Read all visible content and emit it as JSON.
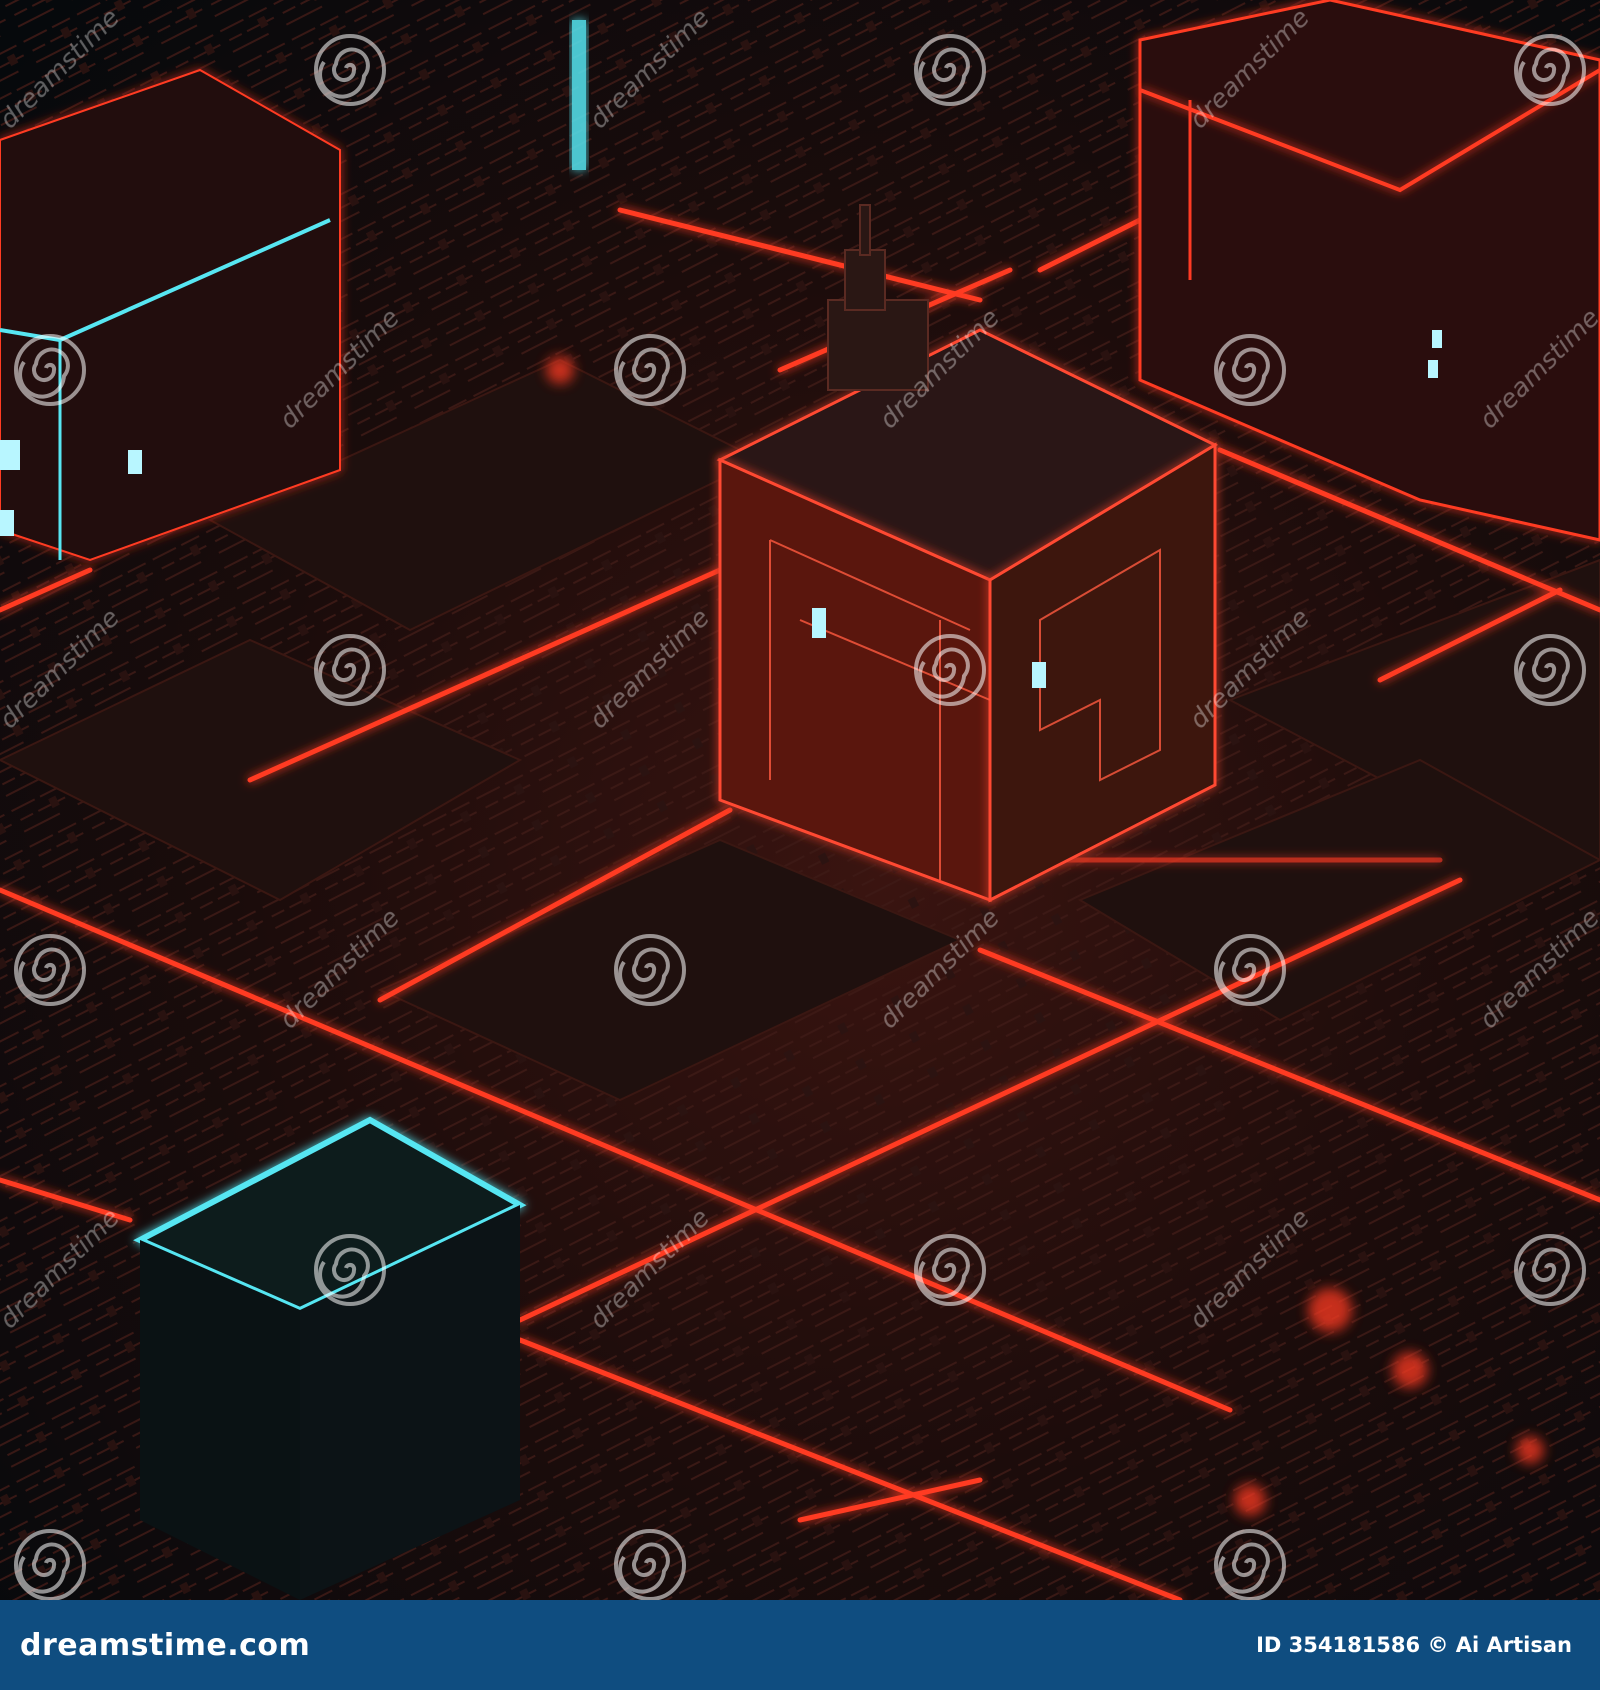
{
  "photo": {
    "description": "Isometric 3D render of a dark circuit-board city grid with red and cyan neon-outlined blocks",
    "colors": {
      "neon_red": "#ff3a24",
      "neon_cyan": "#57e6f2",
      "board_dark": "#1a0d0c",
      "background": "#05080b"
    }
  },
  "watermark": {
    "text": "dreamstime",
    "icon": "dreamstime-spiral-logo"
  },
  "footer": {
    "site": "dreamstime.com",
    "id_label": "ID",
    "id_number": "354181586",
    "copyright_symbol": "©",
    "author": "Ai Artisan",
    "credit": "ID 354181586 © Ai Artisan",
    "background_color": "#0f4d80"
  }
}
